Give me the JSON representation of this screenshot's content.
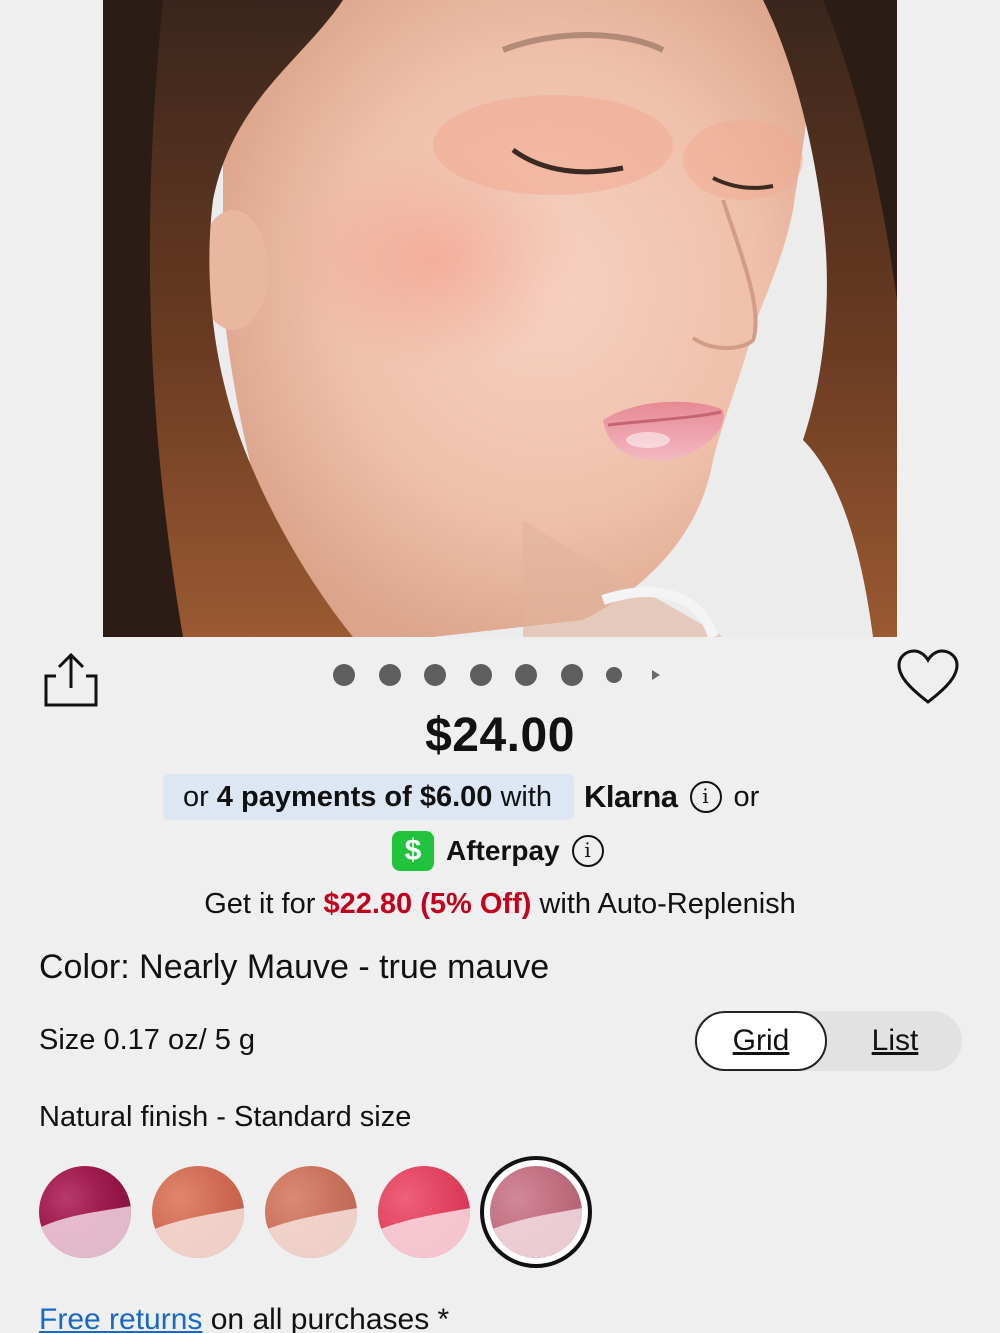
{
  "product": {
    "price": "$24.00",
    "carousel": {
      "dot_count": 8,
      "active_index": 0
    }
  },
  "payments": {
    "klarna_prefix": "or",
    "klarna_bold": "4 payments of $6.00",
    "klarna_suffix": "with",
    "klarna_logo": "Klarna",
    "or_text": "or",
    "afterpay_badge": "$",
    "afterpay_label": "Afterpay",
    "info_glyph": "i"
  },
  "auto_replenish": {
    "prefix": "Get it for",
    "highlight": "$22.80 (5% Off)",
    "suffix": "with Auto-Replenish"
  },
  "color": {
    "label": "Color: Nearly Mauve - true mauve"
  },
  "size": {
    "label": "Size 0.17 oz/ 5 g"
  },
  "view_toggle": {
    "grid": "Grid",
    "list": "List",
    "selected": "Grid"
  },
  "finish": {
    "label": "Natural finish - Standard size"
  },
  "swatches": [
    {
      "name": "berry",
      "color": "#a01c4f",
      "selected": false
    },
    {
      "name": "terracotta",
      "color": "#cf6a54",
      "selected": false
    },
    {
      "name": "rose-brown",
      "color": "#c8725e",
      "selected": false
    },
    {
      "name": "hot-pink",
      "color": "#e0425f",
      "selected": false
    },
    {
      "name": "true-mauve",
      "color": "#c06d7e",
      "selected": true
    }
  ],
  "returns": {
    "link": "Free returns",
    "text": "on all purchases *"
  },
  "colors": {
    "accent_red": "#c2021d",
    "link_blue": "#1669c4",
    "klarna_pill": "#dde7f3",
    "cashapp_green": "#20c33b"
  },
  "icons": [
    "share-icon",
    "heart-icon",
    "info-icon",
    "cashapp-icon"
  ]
}
